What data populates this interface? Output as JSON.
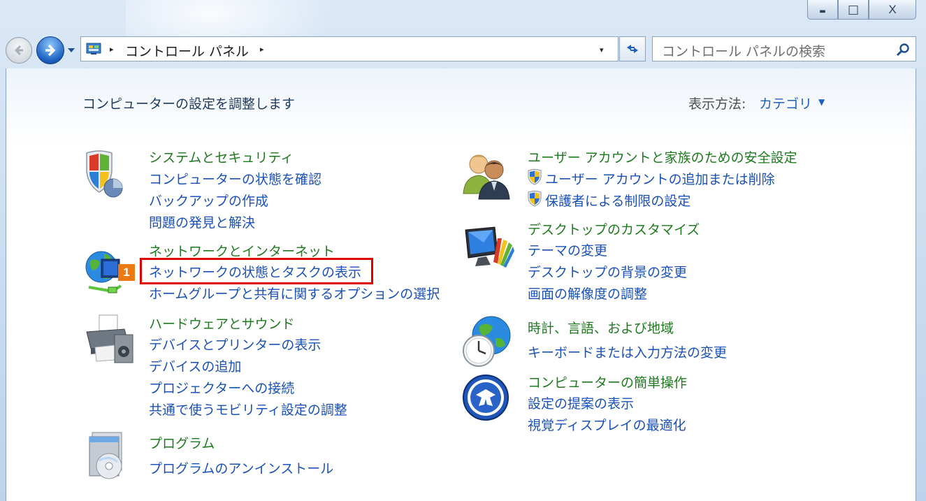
{
  "titlebar": {
    "min_glyph": "▬",
    "max_glyph": "□",
    "close_glyph": "X"
  },
  "address": {
    "crumb": "コントロール パネル",
    "arrow": "▸",
    "dropdown": "▾"
  },
  "search": {
    "placeholder": "コントロール パネルの検索"
  },
  "header": {
    "title": "コンピューターの設定を調整します",
    "view_label": "表示方法:",
    "view_value": "カテゴリ",
    "view_arrow": "▼"
  },
  "categories": {
    "system": {
      "heading": "システムとセキュリティ",
      "links": [
        "コンピューターの状態を確認",
        "バックアップの作成",
        "問題の発見と解決"
      ]
    },
    "network": {
      "heading": "ネットワークとインターネット",
      "links": [
        "ネットワークの状態とタスクの表示",
        "ホームグループと共有に関するオプションの選択"
      ]
    },
    "hardware": {
      "heading": "ハードウェアとサウンド",
      "links": [
        "デバイスとプリンターの表示",
        "デバイスの追加",
        "プロジェクターへの接続",
        "共通で使うモビリティ設定の調整"
      ]
    },
    "programs": {
      "heading": "プログラム",
      "links": [
        "プログラムのアンインストール"
      ]
    },
    "user": {
      "heading": "ユーザー アカウントと家族のための安全設定",
      "links": [
        "ユーザー アカウントの追加または削除",
        "保護者による制限の設定"
      ]
    },
    "desktop": {
      "heading": "デスクトップのカスタマイズ",
      "links": [
        "テーマの変更",
        "デスクトップの背景の変更",
        "画面の解像度の調整"
      ]
    },
    "clock": {
      "heading": "時計、言語、および地域",
      "links": [
        "キーボードまたは入力方法の変更"
      ]
    },
    "ease": {
      "heading": "コンピューターの簡単操作",
      "links": [
        "設定の提案の表示",
        "視覚ディスプレイの最適化"
      ]
    }
  },
  "annotation": {
    "step": "1",
    "box_color": "#e00000",
    "badge_color": "#ec7a12"
  },
  "colors": {
    "link": "#1a51b8",
    "heading": "#1e7a1e",
    "title": "#1e395b"
  }
}
